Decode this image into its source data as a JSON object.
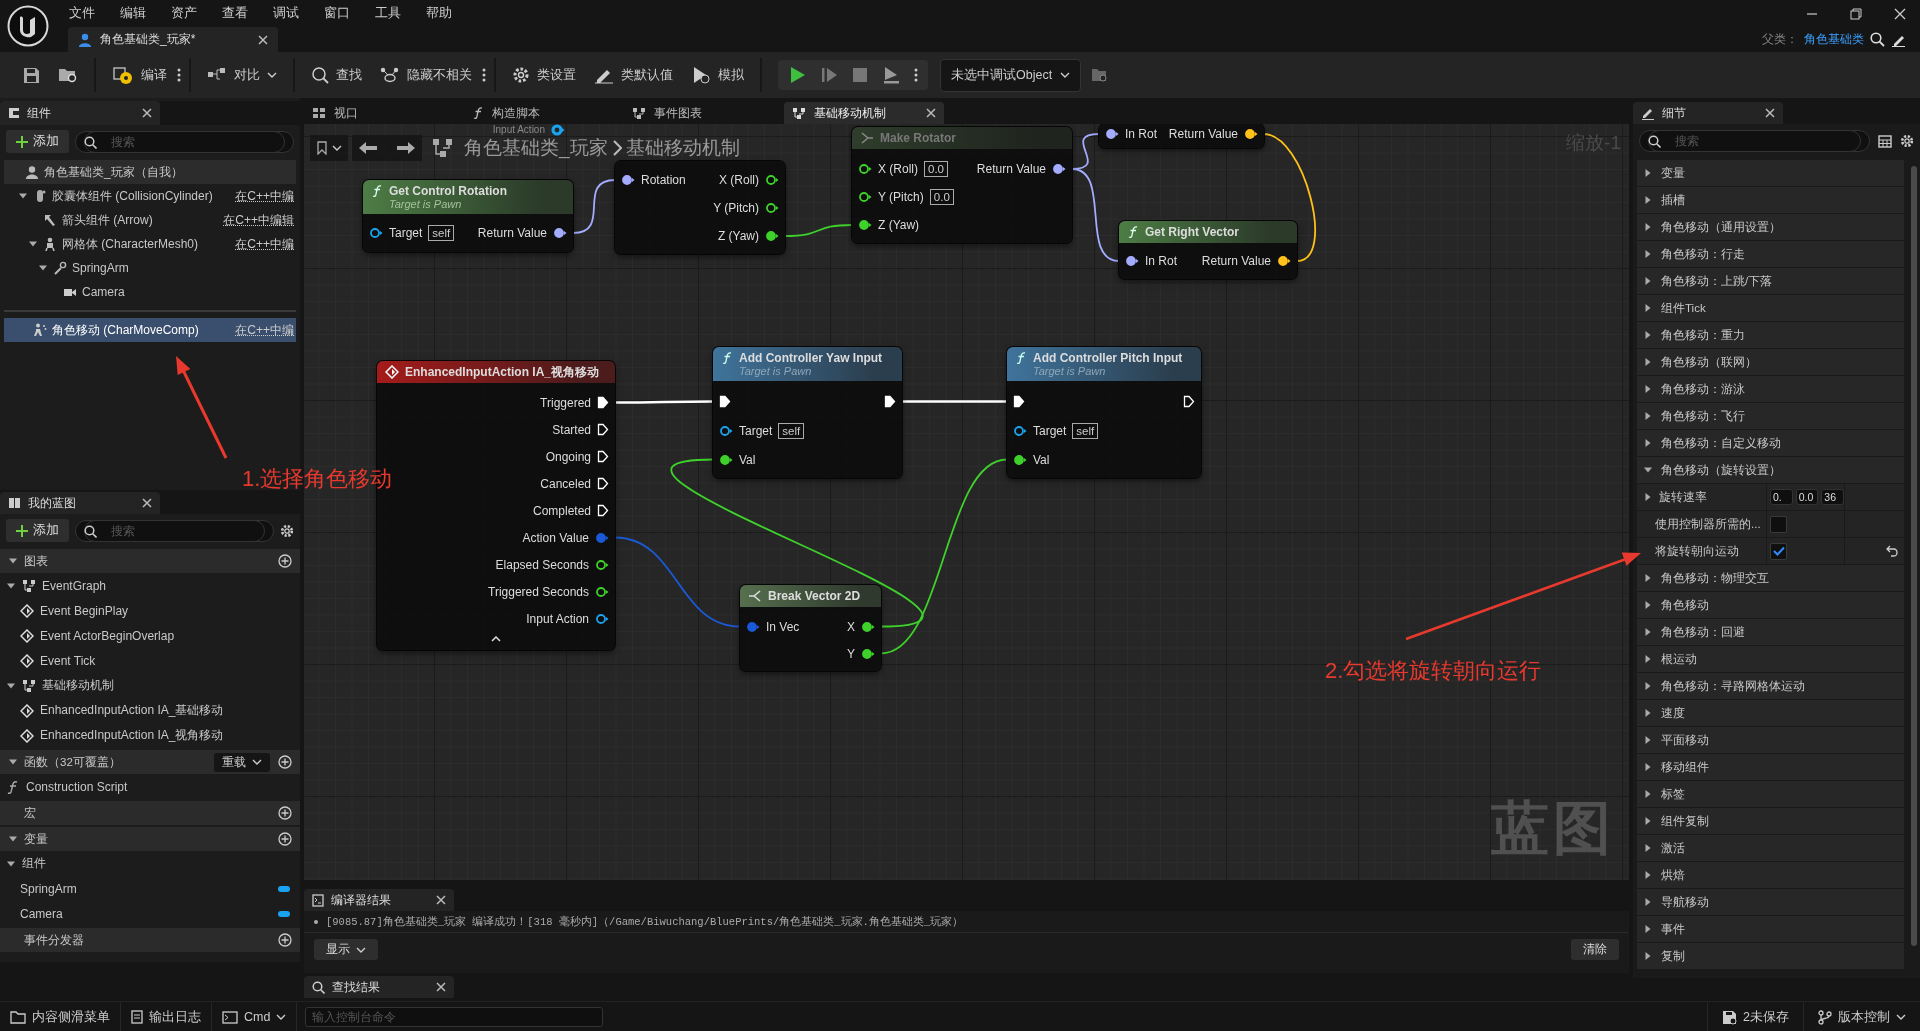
{
  "app_menu": [
    "文件",
    "编辑",
    "资产",
    "查看",
    "调试",
    "窗口",
    "工具",
    "帮助"
  ],
  "document_tab": {
    "label": "角色基础类_玩家*",
    "selected": true
  },
  "parent_class": {
    "label": "父类：",
    "value": "角色基础类"
  },
  "toolbar": {
    "buttons": [
      {
        "label": "编译",
        "dropdown": false
      },
      {
        "label": "对比",
        "dropdown": true
      },
      {
        "label": "查找",
        "dropdown": false
      },
      {
        "label": "隐藏不相关",
        "dropdown": false
      },
      {
        "label": "类设置",
        "dropdown": false
      },
      {
        "label": "类默认值",
        "dropdown": false
      },
      {
        "label": "模拟",
        "dropdown": false
      }
    ],
    "debug_object": "未选中调试Object"
  },
  "components_panel": {
    "title": "组件",
    "add_button": "添加",
    "search_placeholder": "搜索",
    "tree": [
      {
        "label": "角色基础类_玩家（自我）",
        "kind": "actor",
        "selected": false,
        "children": [
          {
            "label": "胶囊体组件 (CollisionCylinder)",
            "kind": "capsule",
            "edit_link": "在C++中编",
            "selected": false,
            "expanded": true,
            "children": [
              {
                "label": "箭头组件 (Arrow)",
                "kind": "arrow",
                "edit_link": "在C++中编辑",
                "selected": false
              },
              {
                "label": "网格体 (CharacterMesh0)",
                "kind": "mesh",
                "edit_link": "在C++中编",
                "selected": false,
                "expanded": true,
                "children": [
                  {
                    "label": "SpringArm",
                    "kind": "spring_arm",
                    "selected": false,
                    "expanded": true,
                    "children": [
                      {
                        "label": "Camera",
                        "kind": "camera",
                        "selected": false
                      }
                    ]
                  }
                ]
              }
            ]
          },
          {
            "label": "角色移动 (CharMoveComp)",
            "kind": "movement",
            "edit_link": "在C++中编",
            "selected": true
          }
        ]
      }
    ]
  },
  "my_blueprint": {
    "title": "我的蓝图",
    "add_button": "添加",
    "search_placeholder": "搜索",
    "sections": [
      {
        "title": "图表",
        "expanded": true,
        "items": [
          {
            "label": "EventGraph",
            "kind": "graph",
            "expanded": true,
            "children": [
              {
                "label": "Event BeginPlay",
                "kind": "event"
              },
              {
                "label": "Event ActorBeginOverlap",
                "kind": "event"
              },
              {
                "label": "Event Tick",
                "kind": "event"
              }
            ]
          },
          {
            "label": "基础移动机制",
            "kind": "graph",
            "expanded": true,
            "children": [
              {
                "label": "EnhancedInputAction IA_基础移动",
                "kind": "event"
              },
              {
                "label": "EnhancedInputAction IA_视角移动",
                "kind": "event"
              }
            ]
          }
        ]
      },
      {
        "title": "函数（32可覆盖）",
        "expanded": true,
        "override_button": "重载",
        "items": [
          {
            "label": "Construction Script",
            "kind": "function"
          }
        ]
      },
      {
        "title": "宏"
      },
      {
        "title": "变量",
        "expanded": true,
        "items": [
          {
            "label": "组件",
            "kind": "category",
            "expanded": true,
            "children": [
              {
                "label": "SpringArm",
                "kind": "variable"
              },
              {
                "label": "Camera",
                "kind": "variable"
              }
            ]
          }
        ]
      },
      {
        "title": "事件分发器"
      }
    ]
  },
  "graph_tabs": [
    {
      "label": "视口",
      "selected": false
    },
    {
      "label": "构造脚本",
      "selected": false
    },
    {
      "label": "事件图表",
      "selected": false
    },
    {
      "label": "基础移动机制",
      "selected": true
    }
  ],
  "breadcrumb": {
    "path": "角色基础类_玩家",
    "current": "基础移动机制",
    "zoom": "缩放-1"
  },
  "graph": {
    "watermark": "蓝图",
    "nodes": [
      {
        "kind": "fragment",
        "rows": [
          {
            "out": {
              "label": "Input Action",
              "kind": "data",
              "color": "#19a4f0",
              "connected": false
            }
          }
        ]
      },
      {
        "kind": "fragment",
        "rows": [
          {
            "in": {
              "label": "Rotation",
              "kind": "data",
              "color": "#a3acff",
              "connected": true
            },
            "out": {
              "label": "X (Roll)",
              "kind": "data",
              "color": "#3ed12b",
              "connected": false
            }
          },
          {
            "out": {
              "label": "Y (Pitch)",
              "kind": "data",
              "color": "#3ed12b",
              "connected": false
            }
          },
          {
            "out": {
              "label": "Z (Yaw)",
              "kind": "data",
              "color": "#3ed12b",
              "connected": true
            }
          }
        ]
      },
      {
        "kind": "make",
        "title": "Make Rotator",
        "rows": [
          {
            "in": {
              "label": "X (Roll)",
              "kind": "data",
              "color": "#3ed12b",
              "connected": false,
              "default": "0.0"
            },
            "out": {
              "label": "Return Value",
              "kind": "data",
              "color": "#a3acff",
              "connected": true
            }
          },
          {
            "in": {
              "label": "Y (Pitch)",
              "kind": "data",
              "color": "#3ed12b",
              "connected": false,
              "default": "0.0"
            }
          },
          {
            "in": {
              "label": "Z (Yaw)",
              "kind": "data",
              "color": "#3ed12b",
              "connected": true
            }
          }
        ]
      },
      {
        "kind": "fragment",
        "rows": [
          {
            "in": {
              "label": "In Rot",
              "kind": "data",
              "color": "#a3acff",
              "connected": true
            },
            "out": {
              "label": "Return Value",
              "kind": "data",
              "color": "#ffc21a",
              "connected": true
            }
          }
        ]
      },
      {
        "kind": "pure",
        "title": "Get Control Rotation",
        "subtitle": "Target is Pawn",
        "rows": [
          {
            "in": {
              "label": "Target",
              "kind": "data",
              "color": "#19a4f0",
              "connected": false,
              "default": "self"
            },
            "out": {
              "label": "Return Value",
              "kind": "data",
              "color": "#a3acff",
              "connected": true
            }
          }
        ]
      },
      {
        "kind": "pure",
        "title": "Get Right Vector",
        "rows": [
          {
            "in": {
              "label": "In Rot",
              "kind": "data",
              "color": "#a3acff",
              "connected": true
            },
            "out": {
              "label": "Return Value",
              "kind": "data",
              "color": "#ffc21a",
              "connected": true
            }
          }
        ]
      },
      {
        "kind": "event",
        "title": "EnhancedInputAction IA_视角移动",
        "rows": [
          {
            "out": {
              "label": "Triggered",
              "kind": "exec",
              "color": "#ffffff",
              "connected": true
            }
          },
          {
            "out": {
              "label": "Started",
              "kind": "exec",
              "color": "#ffffff",
              "connected": false
            }
          },
          {
            "out": {
              "label": "Ongoing",
              "kind": "exec",
              "color": "#ffffff",
              "connected": false
            }
          },
          {
            "out": {
              "label": "Canceled",
              "kind": "exec",
              "color": "#ffffff",
              "connected": false
            }
          },
          {
            "out": {
              "label": "Completed",
              "kind": "exec",
              "color": "#ffffff",
              "connected": false
            }
          },
          {
            "out": {
              "label": "Action Value",
              "kind": "data",
              "color": "#1a5ad8",
              "connected": true
            }
          },
          {
            "out": {
              "label": "Elapsed Seconds",
              "kind": "data",
              "color": "#3ed12b",
              "connected": false
            }
          },
          {
            "out": {
              "label": "Triggered Seconds",
              "kind": "data",
              "color": "#3ed12b",
              "connected": false
            }
          },
          {
            "out": {
              "label": "Input Action",
              "kind": "data",
              "color": "#19a4f0",
              "connected": false
            }
          }
        ]
      },
      {
        "kind": "function",
        "title": "Add Controller Yaw Input",
        "subtitle": "Target is Pawn",
        "rows": [
          {
            "in": {
              "kind": "exec",
              "color": "#ffffff",
              "connected": true
            },
            "out": {
              "kind": "exec",
              "color": "#ffffff",
              "connected": true
            }
          },
          {
            "in": {
              "label": "Target",
              "kind": "data",
              "color": "#19a4f0",
              "connected": false,
              "default": "self"
            }
          },
          {
            "in": {
              "label": "Val",
              "kind": "data",
              "color": "#3ed12b",
              "connected": true
            }
          }
        ]
      },
      {
        "kind": "function",
        "title": "Add Controller Pitch Input",
        "subtitle": "Target is Pawn",
        "rows": [
          {
            "in": {
              "kind": "exec",
              "color": "#ffffff",
              "connected": true
            },
            "out": {
              "kind": "exec",
              "color": "#ffffff",
              "connected": false
            }
          },
          {
            "in": {
              "label": "Target",
              "kind": "data",
              "color": "#19a4f0",
              "connected": false,
              "default": "self"
            }
          },
          {
            "in": {
              "label": "Val",
              "kind": "data",
              "color": "#3ed12b",
              "connected": true
            }
          }
        ]
      },
      {
        "kind": "break",
        "title": "Break Vector 2D",
        "rows": [
          {
            "in": {
              "label": "In Vec",
              "kind": "data",
              "color": "#1a5ad8",
              "connected": true
            },
            "out": {
              "label": "X",
              "kind": "data",
              "color": "#3ed12b",
              "connected": true
            }
          },
          {
            "out": {
              "label": "Y",
              "kind": "data",
              "color": "#3ed12b",
              "connected": true
            }
          }
        ]
      }
    ]
  },
  "compiler_results": {
    "title": "编译器结果",
    "messages": [
      "[9085.87]角色基础类_玩家 编译成功！[318 毫秒内]（/Game/Biwuchang/BluePrints/角色基础类_玩家.角色基础类_玩家）"
    ],
    "show_button": "显示",
    "clear_button": "清除"
  },
  "find_results": {
    "title": "查找结果"
  },
  "details": {
    "title": "细节",
    "search_placeholder": "搜索",
    "rows": [
      {
        "kind": "category",
        "label": "变量",
        "expanded": false
      },
      {
        "kind": "category",
        "label": "插槽",
        "expanded": false
      },
      {
        "kind": "category",
        "label": "角色移动（通用设置）",
        "expanded": false
      },
      {
        "kind": "category",
        "label": "角色移动：行走",
        "expanded": false
      },
      {
        "kind": "category",
        "label": "角色移动：上跳/下落",
        "expanded": false
      },
      {
        "kind": "category",
        "label": "组件Tick",
        "expanded": false
      },
      {
        "kind": "category",
        "label": "角色移动：重力",
        "expanded": false
      },
      {
        "kind": "category",
        "label": "角色移动（联网）",
        "expanded": false
      },
      {
        "kind": "category",
        "label": "角色移动：游泳",
        "expanded": false
      },
      {
        "kind": "category",
        "label": "角色移动：飞行",
        "expanded": false
      },
      {
        "kind": "category",
        "label": "角色移动：自定义移动",
        "expanded": false
      },
      {
        "kind": "category",
        "label": "角色移动（旋转设置）",
        "expanded": true
      },
      {
        "kind": "vector",
        "label": "旋转速率",
        "expanded": false,
        "values": [
          "0.",
          "0.0",
          "36"
        ],
        "modified": false
      },
      {
        "kind": "checkbox",
        "label": "使用控制器所需的...",
        "checked": false,
        "modified": false
      },
      {
        "kind": "checkbox",
        "label": "将旋转朝向运动",
        "checked": true,
        "modified": true
      },
      {
        "kind": "category",
        "label": "角色移动：物理交互",
        "expanded": false
      },
      {
        "kind": "category",
        "label": "角色移动",
        "expanded": false
      },
      {
        "kind": "category",
        "label": "角色移动：回避",
        "expanded": false
      },
      {
        "kind": "category",
        "label": "根运动",
        "expanded": false
      },
      {
        "kind": "category",
        "label": "角色移动：寻路网格体运动",
        "expanded": false
      },
      {
        "kind": "category",
        "label": "速度",
        "expanded": false
      },
      {
        "kind": "category",
        "label": "平面移动",
        "expanded": false
      },
      {
        "kind": "category",
        "label": "移动组件",
        "expanded": false
      },
      {
        "kind": "category",
        "label": "标签",
        "expanded": false
      },
      {
        "kind": "category",
        "label": "组件复制",
        "expanded": false
      },
      {
        "kind": "category",
        "label": "激活",
        "expanded": false
      },
      {
        "kind": "category",
        "label": "烘焙",
        "expanded": false
      },
      {
        "kind": "category",
        "label": "导航移动",
        "expanded": false
      },
      {
        "kind": "category",
        "label": "事件",
        "expanded": false
      },
      {
        "kind": "category",
        "label": "复制",
        "expanded": false
      }
    ]
  },
  "status_bar": {
    "content_drawer": "内容侧滑菜单",
    "output_log": "输出日志",
    "console_mode": "Cmd",
    "console_placeholder": "输入控制台命令",
    "unsaved": "2未保存",
    "source_control": "版本控制"
  },
  "annotations": [
    {
      "text": "1.选择角色移动"
    },
    {
      "text": "2.勾选将旋转朝向运行"
    }
  ]
}
